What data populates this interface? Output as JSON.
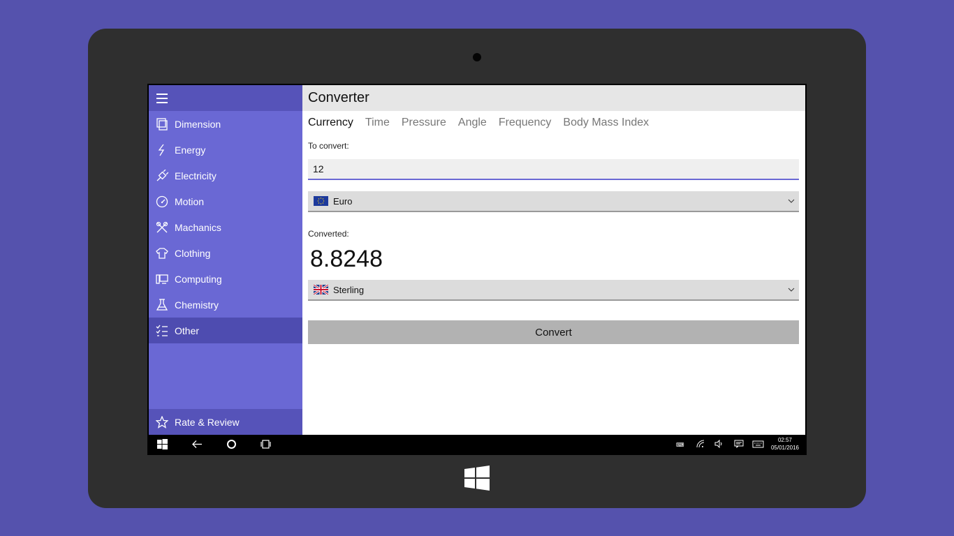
{
  "app": {
    "title": "Converter"
  },
  "sidebar": {
    "items": [
      {
        "label": "Dimension",
        "icon": "dimension-icon"
      },
      {
        "label": "Energy",
        "icon": "lightning-icon"
      },
      {
        "label": "Electricity",
        "icon": "plug-icon"
      },
      {
        "label": "Motion",
        "icon": "speedometer-icon"
      },
      {
        "label": "Machanics",
        "icon": "tools-icon"
      },
      {
        "label": "Clothing",
        "icon": "shirt-icon"
      },
      {
        "label": "Computing",
        "icon": "computer-icon"
      },
      {
        "label": "Chemistry",
        "icon": "flask-icon"
      },
      {
        "label": "Other",
        "icon": "checklist-icon"
      }
    ],
    "active": "Other",
    "rate_label": "Rate & Review"
  },
  "tabs": [
    {
      "label": "Currency"
    },
    {
      "label": "Time"
    },
    {
      "label": "Pressure"
    },
    {
      "label": "Angle"
    },
    {
      "label": "Frequency"
    },
    {
      "label": "Body Mass Index"
    }
  ],
  "form": {
    "to_convert_label": "To convert:",
    "input_value": "12",
    "from_currency": "Euro",
    "converted_label": "Converted:",
    "result": "8.8248",
    "to_currency": "Sterling",
    "convert_button": "Convert"
  },
  "taskbar": {
    "time": "02:57",
    "date": "05/01/2016"
  },
  "colors": {
    "background": "#5552ad",
    "sidebar": "#6a68d4",
    "sidebar_dark": "#5653b9",
    "accent": "#6a68d4"
  }
}
